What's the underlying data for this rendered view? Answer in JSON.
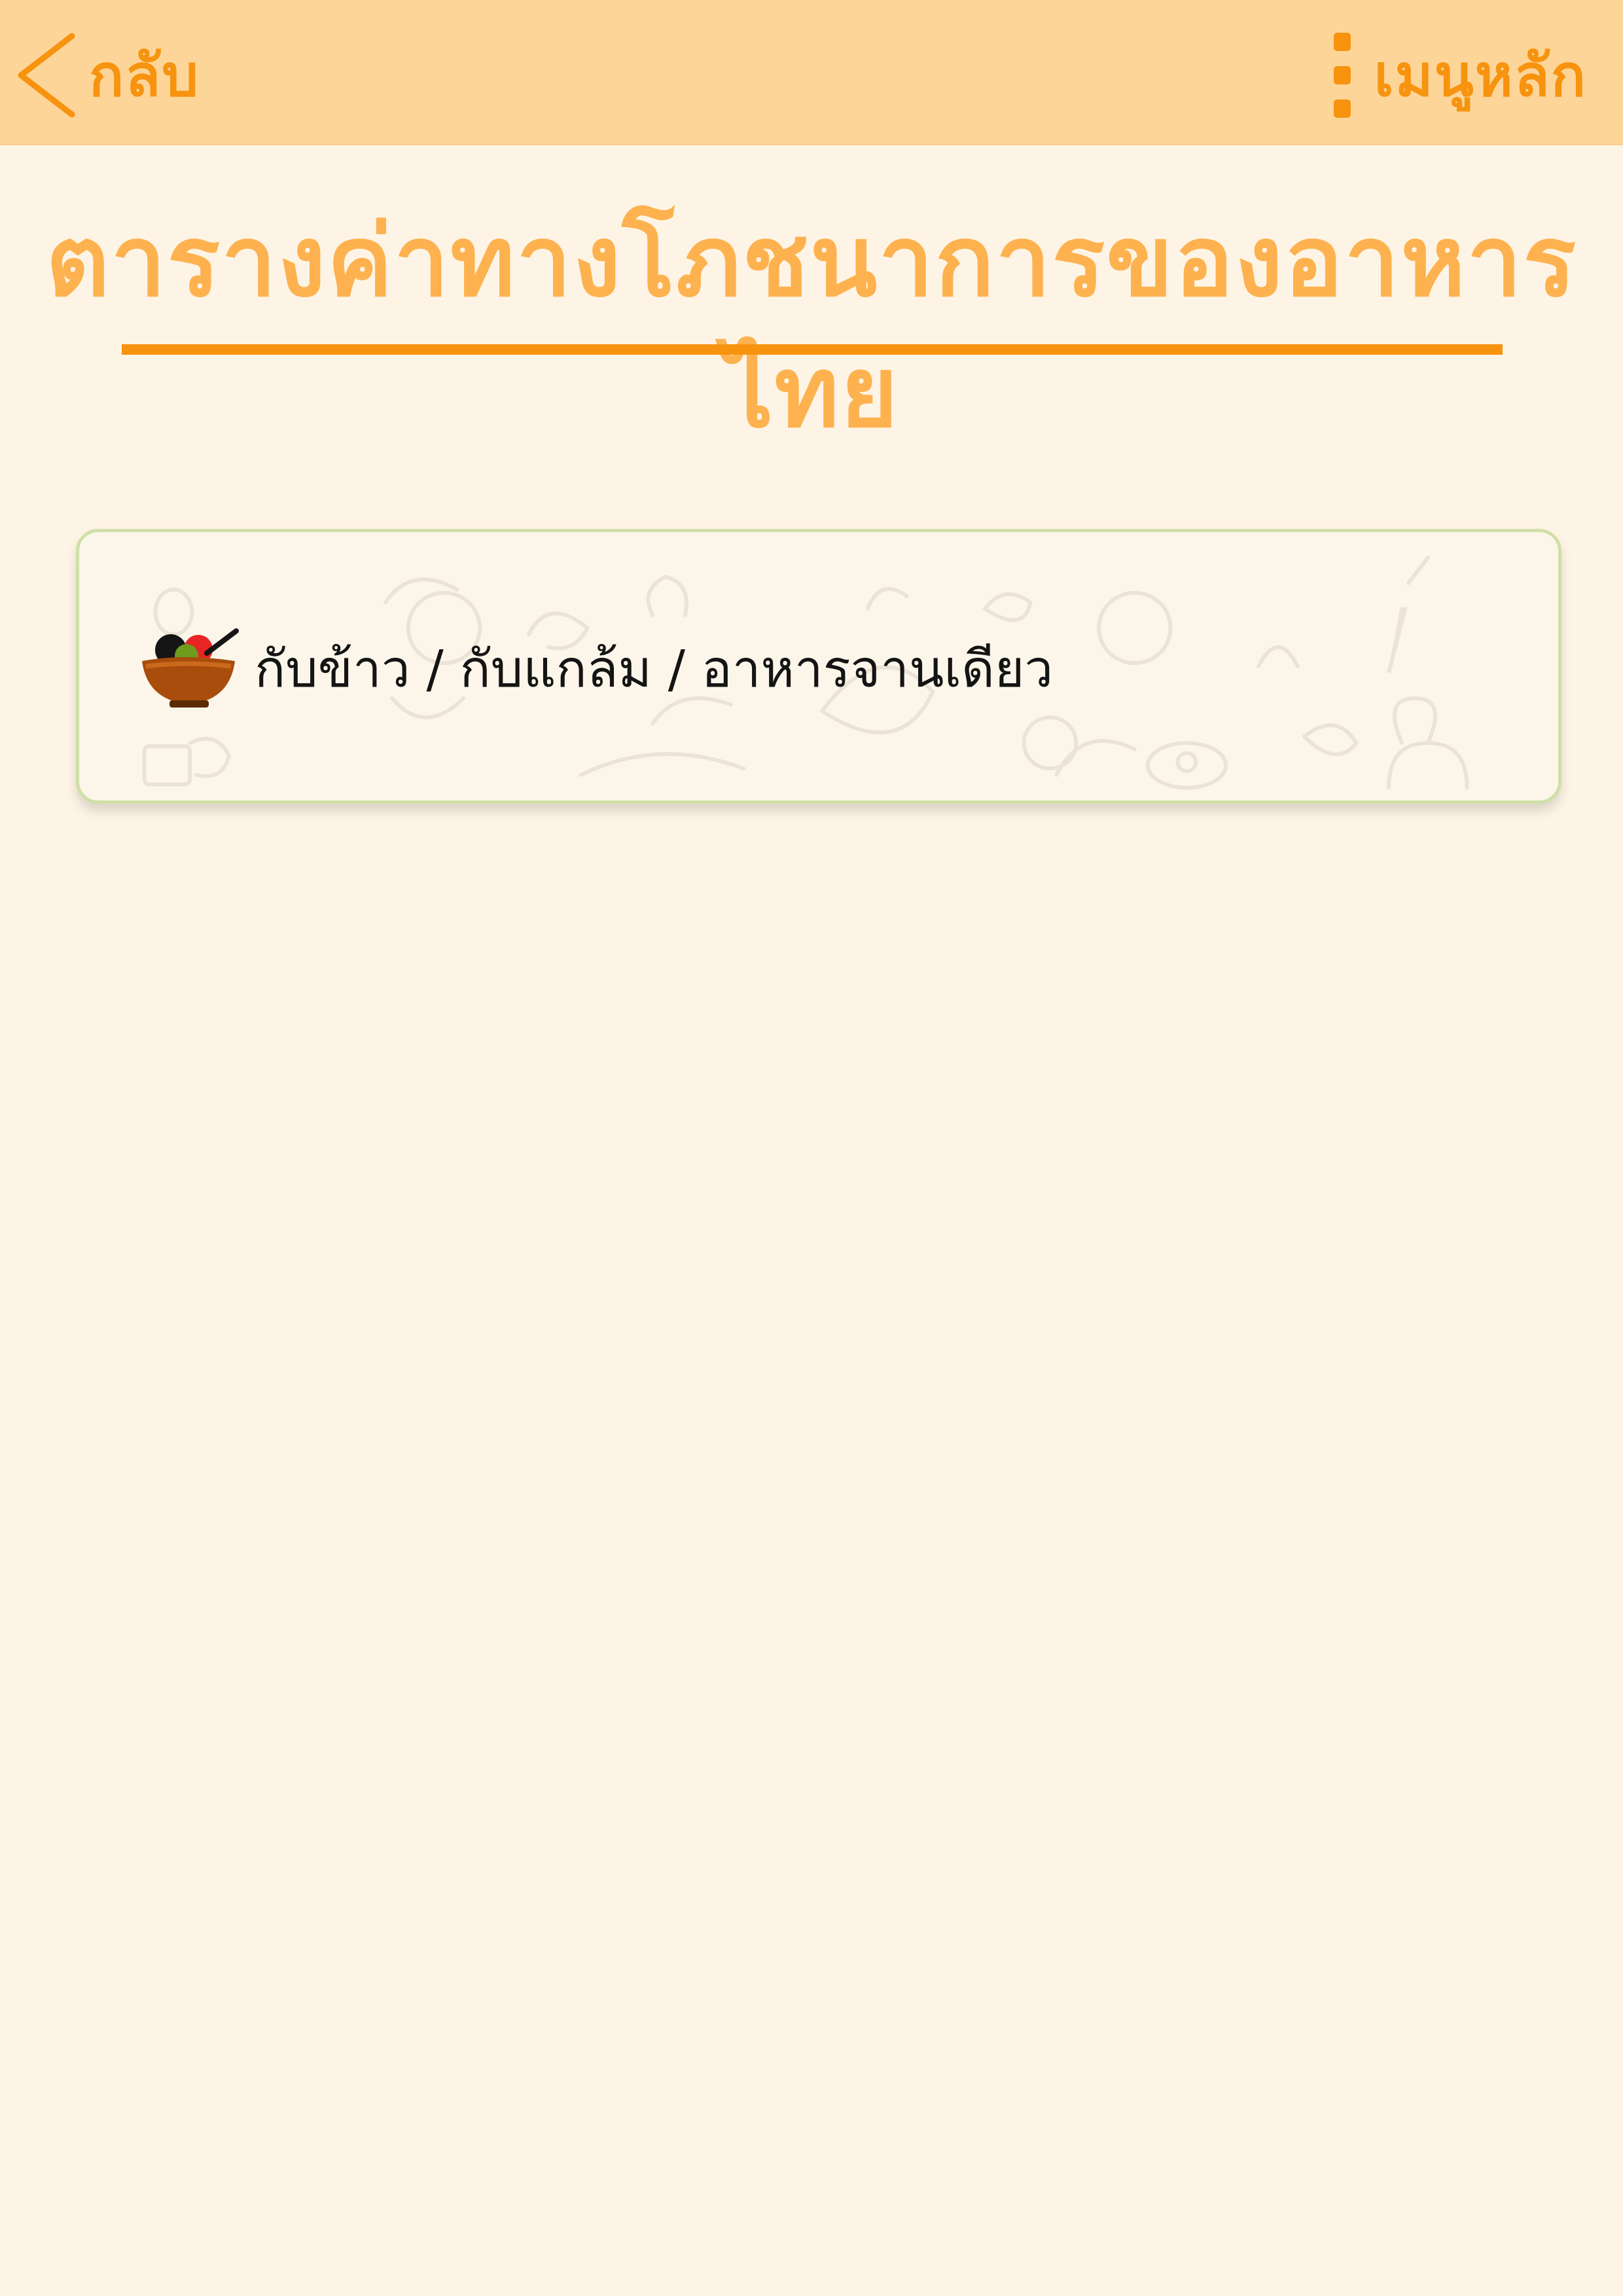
{
  "header": {
    "back_label": "กลับ",
    "menu_label": "เมนูหลัก"
  },
  "page": {
    "title": "ตารางค่าทางโภชนาการของอาหารไทย"
  },
  "categories": [
    {
      "label": "กับข้าว / กับแกล้ม / อาหารจานเดียว",
      "icon": "food-bowl-icon"
    }
  ],
  "colors": {
    "accent": "#f7930f",
    "header_bg": "#fed598",
    "title": "#fdb24f",
    "page_bg": "#fef4e6",
    "card_border": "#cfe0a8"
  }
}
